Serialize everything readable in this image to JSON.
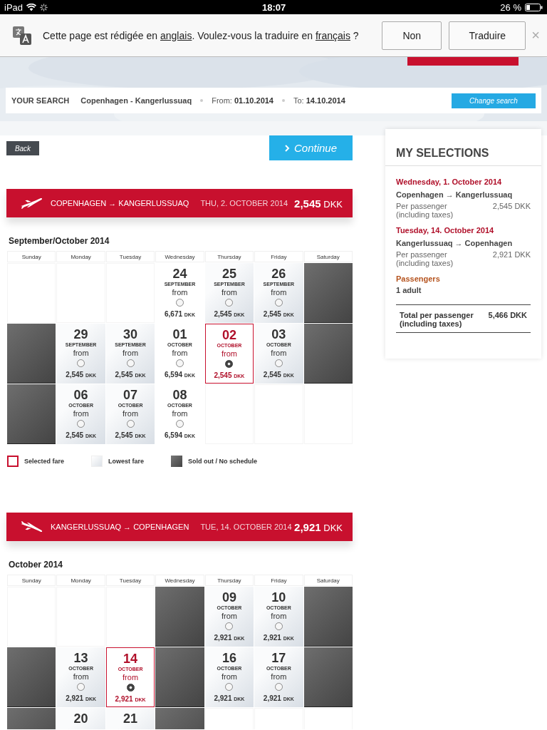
{
  "status_bar": {
    "device": "iPad",
    "time": "18:07",
    "battery": "26 %"
  },
  "translate_bar": {
    "before": "Cette page est rédigée en ",
    "link_1": "anglais",
    "middle": ". Voulez-vous la traduire en ",
    "link_2": "français",
    "after": " ?",
    "buttons": [
      "Non",
      "Traduire"
    ],
    "close": "×"
  },
  "search": {
    "label": "YOUR SEARCH",
    "route": "Copenhagen - Kangerlussuaq",
    "from_label": "From:",
    "from": "01.10.2014",
    "to_label": "To:",
    "to": "14.10.2014",
    "button": "Change search"
  },
  "back": "Back",
  "continue": "Continue",
  "selections": {
    "title": "MY SELECTIONS",
    "legs": [
      {
        "date": "Wednesday, 1. October 2014",
        "route": "Copenhagen → Kangerlussuaq",
        "label": "Per passenger (including taxes)",
        "price": "2,545 DKK"
      },
      {
        "date": "Tuesday, 14. October 2014",
        "route": "Kangerlussuaq → Copenhagen",
        "label": "Per passenger (including taxes)",
        "price": "2,921 DKK"
      }
    ],
    "passengers_label": "Passengers",
    "passengers": "1 adult",
    "total_label": "Total per passenger (including taxes)",
    "total": "5,466 DKK"
  },
  "flights": [
    {
      "kind": "departure",
      "route": "COPENHAGEN → KANGERLUSSUAQ",
      "date": "THU, 2. OCTOBER 2014",
      "price": "2,545",
      "currency": "DKK",
      "month": "September/October 2014",
      "weekdays": [
        "Sunday",
        "Monday",
        "Tuesday",
        "Wednesday",
        "Thursday",
        "Friday",
        "Saturday"
      ],
      "cells": [
        {
          "kind": "empty"
        },
        {
          "kind": "empty"
        },
        {
          "kind": "empty"
        },
        {
          "kind": "fare",
          "day": "24",
          "month": "SEPTEMBER",
          "from": "from",
          "price": "6,671",
          "currency": "DKK",
          "lowest": false,
          "selected": false
        },
        {
          "kind": "fare",
          "day": "25",
          "month": "SEPTEMBER",
          "from": "from",
          "price": "2,545",
          "currency": "DKK",
          "lowest": true,
          "selected": false
        },
        {
          "kind": "fare",
          "day": "26",
          "month": "SEPTEMBER",
          "from": "from",
          "price": "2,545",
          "currency": "DKK",
          "lowest": true,
          "selected": false
        },
        {
          "kind": "soldout"
        },
        {
          "kind": "soldout"
        },
        {
          "kind": "fare",
          "day": "29",
          "month": "SEPTEMBER",
          "from": "from",
          "price": "2,545",
          "currency": "DKK",
          "lowest": true,
          "selected": false
        },
        {
          "kind": "fare",
          "day": "30",
          "month": "SEPTEMBER",
          "from": "from",
          "price": "2,545",
          "currency": "DKK",
          "lowest": true,
          "selected": false
        },
        {
          "kind": "fare",
          "day": "01",
          "month": "OCTOBER",
          "from": "from",
          "price": "6,594",
          "currency": "DKK",
          "lowest": false,
          "selected": false
        },
        {
          "kind": "fare",
          "day": "02",
          "month": "OCTOBER",
          "from": "from",
          "price": "2,545",
          "currency": "DKK",
          "lowest": true,
          "selected": true
        },
        {
          "kind": "fare",
          "day": "03",
          "month": "OCTOBER",
          "from": "from",
          "price": "2,545",
          "currency": "DKK",
          "lowest": true,
          "selected": false
        },
        {
          "kind": "soldout"
        },
        {
          "kind": "soldout"
        },
        {
          "kind": "fare",
          "day": "06",
          "month": "OCTOBER",
          "from": "from",
          "price": "2,545",
          "currency": "DKK",
          "lowest": true,
          "selected": false
        },
        {
          "kind": "fare",
          "day": "07",
          "month": "OCTOBER",
          "from": "from",
          "price": "2,545",
          "currency": "DKK",
          "lowest": true,
          "selected": false
        },
        {
          "kind": "fare",
          "day": "08",
          "month": "OCTOBER",
          "from": "from",
          "price": "6,594",
          "currency": "DKK",
          "lowest": false,
          "selected": false
        },
        {
          "kind": "empty"
        },
        {
          "kind": "empty"
        },
        {
          "kind": "empty"
        }
      ],
      "legend": [
        {
          "kind": "selected",
          "label": "Selected fare"
        },
        {
          "kind": "lowest",
          "label": "Lowest fare"
        },
        {
          "kind": "soldout",
          "label": "Sold out / No schedule"
        }
      ]
    },
    {
      "kind": "return",
      "route": "KANGERLUSSUAQ → COPENHAGEN",
      "date": "TUE, 14. OCTOBER 2014",
      "price": "2,921",
      "currency": "DKK",
      "month": "October 2014",
      "weekdays": [
        "Sunday",
        "Monday",
        "Tuesday",
        "Wednesday",
        "Thursday",
        "Friday",
        "Saturday"
      ],
      "cells": [
        {
          "kind": "empty"
        },
        {
          "kind": "empty"
        },
        {
          "kind": "empty"
        },
        {
          "kind": "soldout"
        },
        {
          "kind": "fare",
          "day": "09",
          "month": "OCTOBER",
          "from": "from",
          "price": "2,921",
          "currency": "DKK",
          "lowest": true,
          "selected": false
        },
        {
          "kind": "fare",
          "day": "10",
          "month": "OCTOBER",
          "from": "from",
          "price": "2,921",
          "currency": "DKK",
          "lowest": true,
          "selected": false
        },
        {
          "kind": "soldout"
        },
        {
          "kind": "soldout"
        },
        {
          "kind": "fare",
          "day": "13",
          "month": "OCTOBER",
          "from": "from",
          "price": "2,921",
          "currency": "DKK",
          "lowest": true,
          "selected": false
        },
        {
          "kind": "fare",
          "day": "14",
          "month": "OCTOBER",
          "from": "from",
          "price": "2,921",
          "currency": "DKK",
          "lowest": true,
          "selected": true
        },
        {
          "kind": "soldout"
        },
        {
          "kind": "fare",
          "day": "16",
          "month": "OCTOBER",
          "from": "from",
          "price": "2,921",
          "currency": "DKK",
          "lowest": true,
          "selected": false
        },
        {
          "kind": "fare",
          "day": "17",
          "month": "OCTOBER",
          "from": "from",
          "price": "2,921",
          "currency": "DKK",
          "lowest": true,
          "selected": false
        },
        {
          "kind": "soldout"
        },
        {
          "kind": "soldout"
        },
        {
          "kind": "partial",
          "day": "20",
          "lowest": true
        },
        {
          "kind": "partial",
          "day": "21",
          "lowest": true
        },
        {
          "kind": "soldout"
        },
        {
          "kind": "empty"
        },
        {
          "kind": "empty"
        },
        {
          "kind": "empty"
        }
      ]
    }
  ]
}
